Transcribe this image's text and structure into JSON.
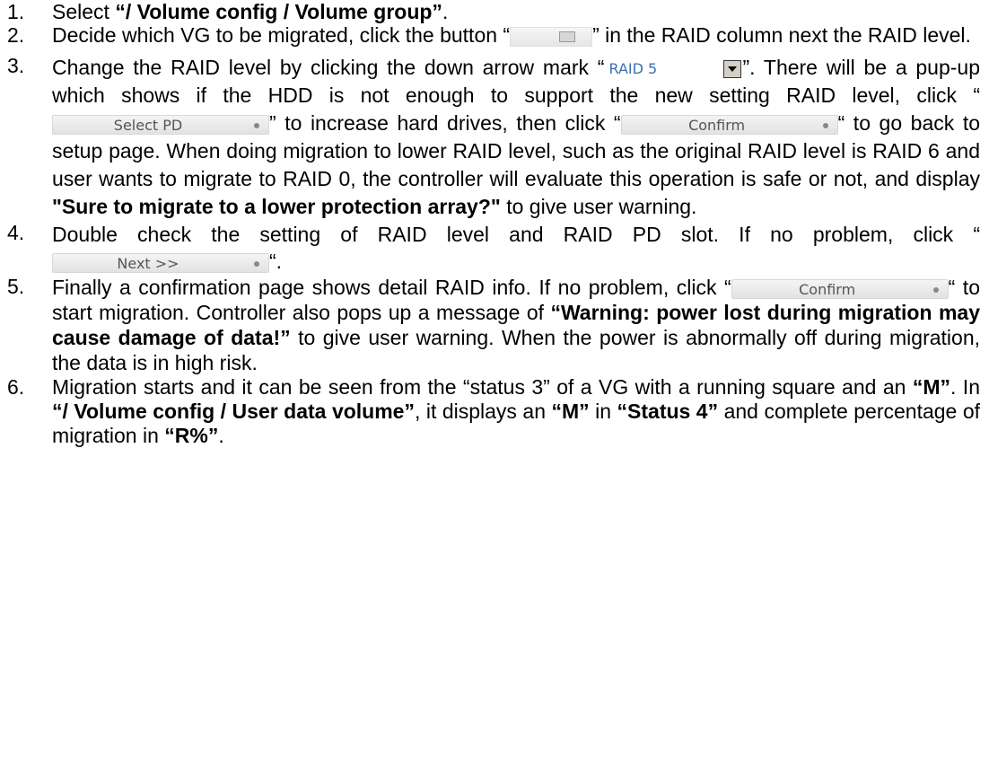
{
  "steps": [
    {
      "num": "1.",
      "a": "Select ",
      "b1": "“/ Volume config / Volume group”",
      "c": "."
    },
    {
      "num": "2.",
      "a": "Decide which VG to be migrated, click the button “",
      "icon": "migrate-icon",
      "c": "” in the RAID column next the RAID level."
    },
    {
      "num": "3.",
      "a": "Change the RAID level by clicking the down arrow mark “",
      "select_value": "RAID 5",
      "b": "”. There will be a pup-up which shows if the HDD is not enough to support the new setting RAID level, click “",
      "select_pd_label": "Select PD",
      "c": "” to increase hard drives, then click “",
      "confirm_label": "Confirm",
      "d": "“ to go back to setup page. When doing migration to lower RAID level, such as the original RAID level is RAID 6 and user wants to migrate to RAID 0, the controller will evaluate this operation is safe or not, and display ",
      "b1": "\"Sure to migrate to a lower protection array?\"",
      "e": " to give user warning."
    },
    {
      "num": "4.",
      "a": "Double check the setting of RAID level and RAID PD slot. If no problem, click “",
      "next_label": "Next >>",
      "c": "“."
    },
    {
      "num": "5.",
      "a": "Finally a confirmation page shows detail RAID info. If no problem, click “",
      "confirm_label": "Confirm",
      "b": "“ to start migration. Controller also pops up a message of ",
      "b1": "“Warning: power lost during migration may cause damage of data!”",
      "c": " to give user warning. When the power is abnormally off during migration, the data is in high risk."
    },
    {
      "num": "6.",
      "a": "Migration starts and it can be seen from the “status 3” of a VG with a running square and an ",
      "b1": "“M”",
      "b": ". In ",
      "b2": "“/ Volume config / User data volume”",
      "c": ", it displays an ",
      "b3": "“M”",
      "d": " in ",
      "b4": "“Status 4”",
      "e": " and complete percentage of migration in ",
      "b5": "“R%”",
      "f": "."
    }
  ]
}
